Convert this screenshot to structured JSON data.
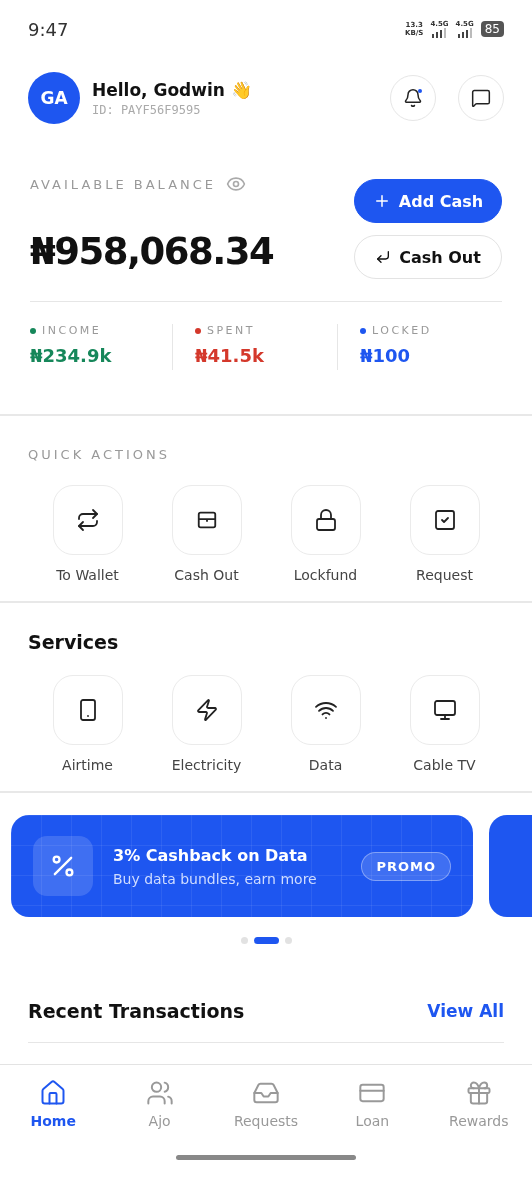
{
  "status_bar": {
    "time": "9:47",
    "speed_value": "13.3",
    "speed_unit": "KB/S",
    "network_1": "4.5G",
    "network_2": "4.5G",
    "battery": "85"
  },
  "header": {
    "avatar": "GA",
    "greeting": "Hello, Godwin 👋",
    "user_id": "ID: PAYF56F9595",
    "notification_dot": true
  },
  "balance": {
    "label": "AVAILABLE BALANCE",
    "amount": "₦958,068.34",
    "buttons": [
      {
        "kind": "primary",
        "label": "Add Cash"
      },
      {
        "kind": "secondary",
        "label": "Cash Out"
      }
    ]
  },
  "stats": [
    {
      "label": "INCOME",
      "value": "₦234.9k",
      "color": "#16875a"
    },
    {
      "label": "SPENT",
      "value": "₦41.5k",
      "color": "#d4382b"
    },
    {
      "label": "LOCKED",
      "value": "₦100",
      "color": "#1e56f0"
    }
  ],
  "quick_actions": {
    "title": "QUICK ACTIONS",
    "items": [
      {
        "kind": "transfer",
        "label": "To Wallet"
      },
      {
        "kind": "cashout",
        "label": "Cash Out"
      },
      {
        "kind": "lock",
        "label": "Lockfund"
      },
      {
        "kind": "request",
        "label": "Request"
      }
    ]
  },
  "services": {
    "title": "Services",
    "items": [
      {
        "kind": "phone",
        "label": "Airtime"
      },
      {
        "kind": "bolt",
        "label": "Electricity"
      },
      {
        "kind": "wifi",
        "label": "Data"
      },
      {
        "kind": "tv",
        "label": "Cable TV"
      }
    ]
  },
  "promo": {
    "title": "3% Cashback on Data",
    "subtitle": "Buy data bundles, earn more",
    "badge": "PROMO",
    "dots": [
      {
        "selected": false
      },
      {
        "selected": true
      },
      {
        "selected": false
      }
    ]
  },
  "recent": {
    "title": "Recent Transactions",
    "link": "View All"
  },
  "nav": [
    {
      "kind": "home",
      "label": "Home",
      "selected": true
    },
    {
      "kind": "users",
      "label": "Ajo",
      "selected": false
    },
    {
      "kind": "inbox",
      "label": "Requests",
      "selected": false
    },
    {
      "kind": "card",
      "label": "Loan",
      "selected": false
    },
    {
      "kind": "gift",
      "label": "Rewards",
      "selected": false
    }
  ]
}
